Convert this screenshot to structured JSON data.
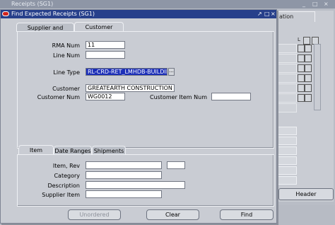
{
  "background_window": {
    "title": "Receipts (SG1)",
    "tab_label": "ation",
    "header_button": "Header"
  },
  "dialog": {
    "title": "Find Expected Receipts (SG1)",
    "top_tabs": [
      "Supplier and Internal",
      "Customer"
    ],
    "active_top_tab": "Customer",
    "fields": {
      "rma_num": {
        "label": "RMA Num",
        "value": "11"
      },
      "line_num": {
        "label": "Line Num",
        "value": ""
      },
      "line_type": {
        "label": "Line Type",
        "value": "RL-CRD-RET_LMHDB-BUILDING"
      },
      "customer": {
        "label": "Customer",
        "value": "GREATEARTH CONSTRUCTION PTE"
      },
      "customer_num": {
        "label": "Customer Num",
        "value": "WG0012"
      },
      "customer_item_num": {
        "label": "Customer Item Num",
        "value": ""
      }
    },
    "bottom_tabs": [
      "Item",
      "Date Ranges",
      "Shipments"
    ],
    "active_bottom_tab": "Item",
    "item_fields": {
      "item_rev": {
        "label": "Item, Rev",
        "value": "",
        "rev": ""
      },
      "category": {
        "label": "Category",
        "value": ""
      },
      "description": {
        "label": "Description",
        "value": ""
      },
      "supplier_item": {
        "label": "Supplier Item",
        "value": ""
      }
    },
    "buttons": {
      "unordered": "Unordered",
      "clear": "Clear",
      "find": "Find"
    }
  },
  "colors": {
    "title_bar": "#27408b",
    "selection": "#1c2fb8",
    "panel": "#c9ccd3"
  }
}
